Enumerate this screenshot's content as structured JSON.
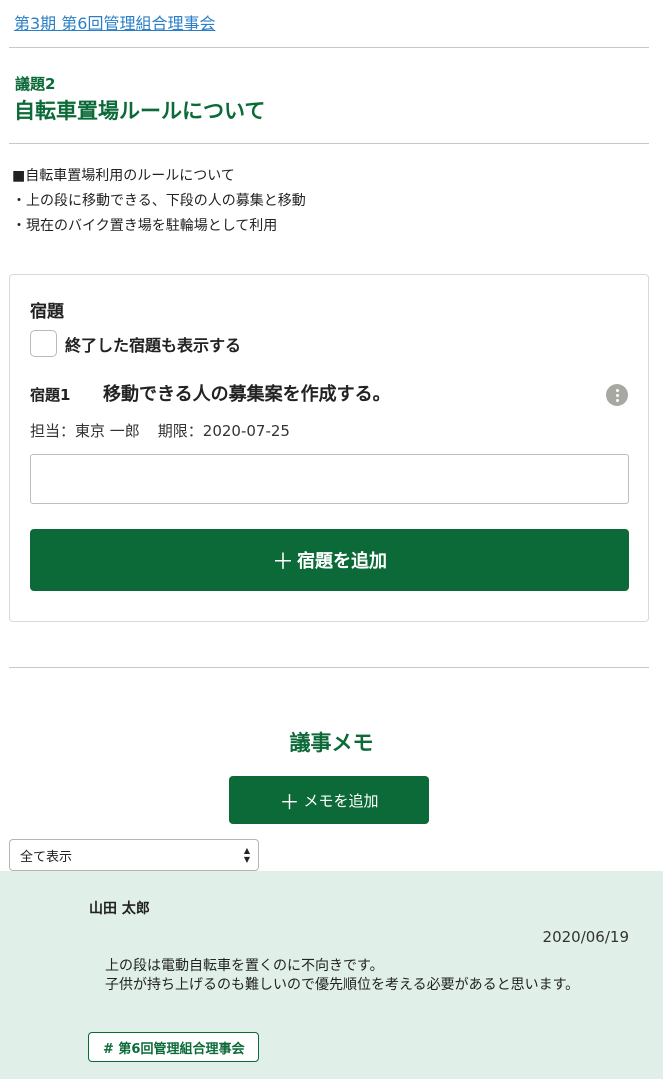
{
  "breadcrumb": "第3期 第6回管理組合理事会",
  "agenda": {
    "number": "議題2",
    "title": "自転車置場ルールについて",
    "description": [
      "■自転車置場利用のルールについて",
      "・上の段に移動できる、下段の人の募集と移動",
      "・現在のバイク置き場を駐輪場として利用"
    ]
  },
  "tasks": {
    "heading": "宿題",
    "show_completed_label": "終了した宿題も表示する",
    "items": [
      {
        "number": "宿題1",
        "text": "移動できる人の募集案を作成する。",
        "assignee": "担当：東京 一郎",
        "deadline": "期限：2020-07-25"
      }
    ],
    "input_value": "",
    "add_button_plus": "＋",
    "add_button_label": "宿題を追加",
    "more_icon": "more-vert-icon"
  },
  "memo": {
    "heading": "議事メモ",
    "add_button_plus": "＋",
    "add_button_label": "メモを追加",
    "filter_selected": "全て表示",
    "items": [
      {
        "author": "山田 太郎",
        "date": "2020/06/19",
        "body": "上の段は電動自転車を置くのに不向きです。\n子供が持ち上げるのも難しいので優先順位を考える必要があると思います。",
        "tag": "# 第6回管理組合理事会"
      }
    ]
  },
  "colors": {
    "brand_green": "#0c6a38",
    "link_blue": "#2a7fc7",
    "memo_bg": "#e0f0e8"
  }
}
